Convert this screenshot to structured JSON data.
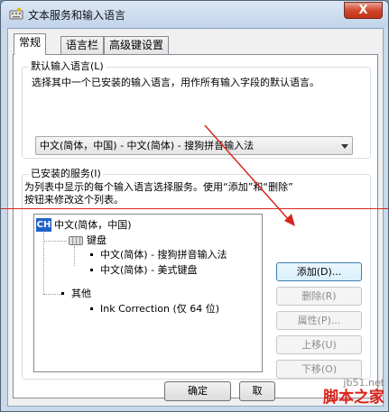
{
  "window": {
    "title": "文本服务和输入语言",
    "close_label": "X"
  },
  "tabs": [
    {
      "label": "常规",
      "active": true
    },
    {
      "label": "语言栏",
      "active": false
    },
    {
      "label": "高级键设置",
      "active": false
    }
  ],
  "default_language": {
    "heading": "默认输入语言(L)",
    "description": "选择其中一个已安装的输入语言，用作所有输入字段的默认语言。",
    "selected": "中文(简体，中国) - 中文(简体) - 搜狗拼音输入法"
  },
  "installed_services": {
    "heading": "已安装的服务(I)",
    "description_line1": "为列表中显示的每个输入语言选择服务。使用“添加”和“删除”",
    "description_line2": "按钮来修改这个列表。",
    "tree": {
      "language_badge": "CH",
      "language": "中文(简体，中国)",
      "keyboard_group": "键盘",
      "keyboards": [
        "中文(简体) - 搜狗拼音输入法",
        "中文(简体) - 美式键盘"
      ],
      "other_group": "其他",
      "others": [
        "Ink Correction (仅 64 位)"
      ]
    },
    "buttons": {
      "add": "添加(D)...",
      "remove": "删除(R)",
      "properties": "属性(P)...",
      "move_up": "上移(U)",
      "move_down": "下移(O)"
    }
  },
  "footer": {
    "ok": "确定",
    "cancel": "取"
  },
  "watermark": {
    "line1": "jb51.net",
    "line2": "脚本之家"
  },
  "colors": {
    "annotation_red": "#d8261e",
    "badge_blue": "#1f63c6"
  }
}
